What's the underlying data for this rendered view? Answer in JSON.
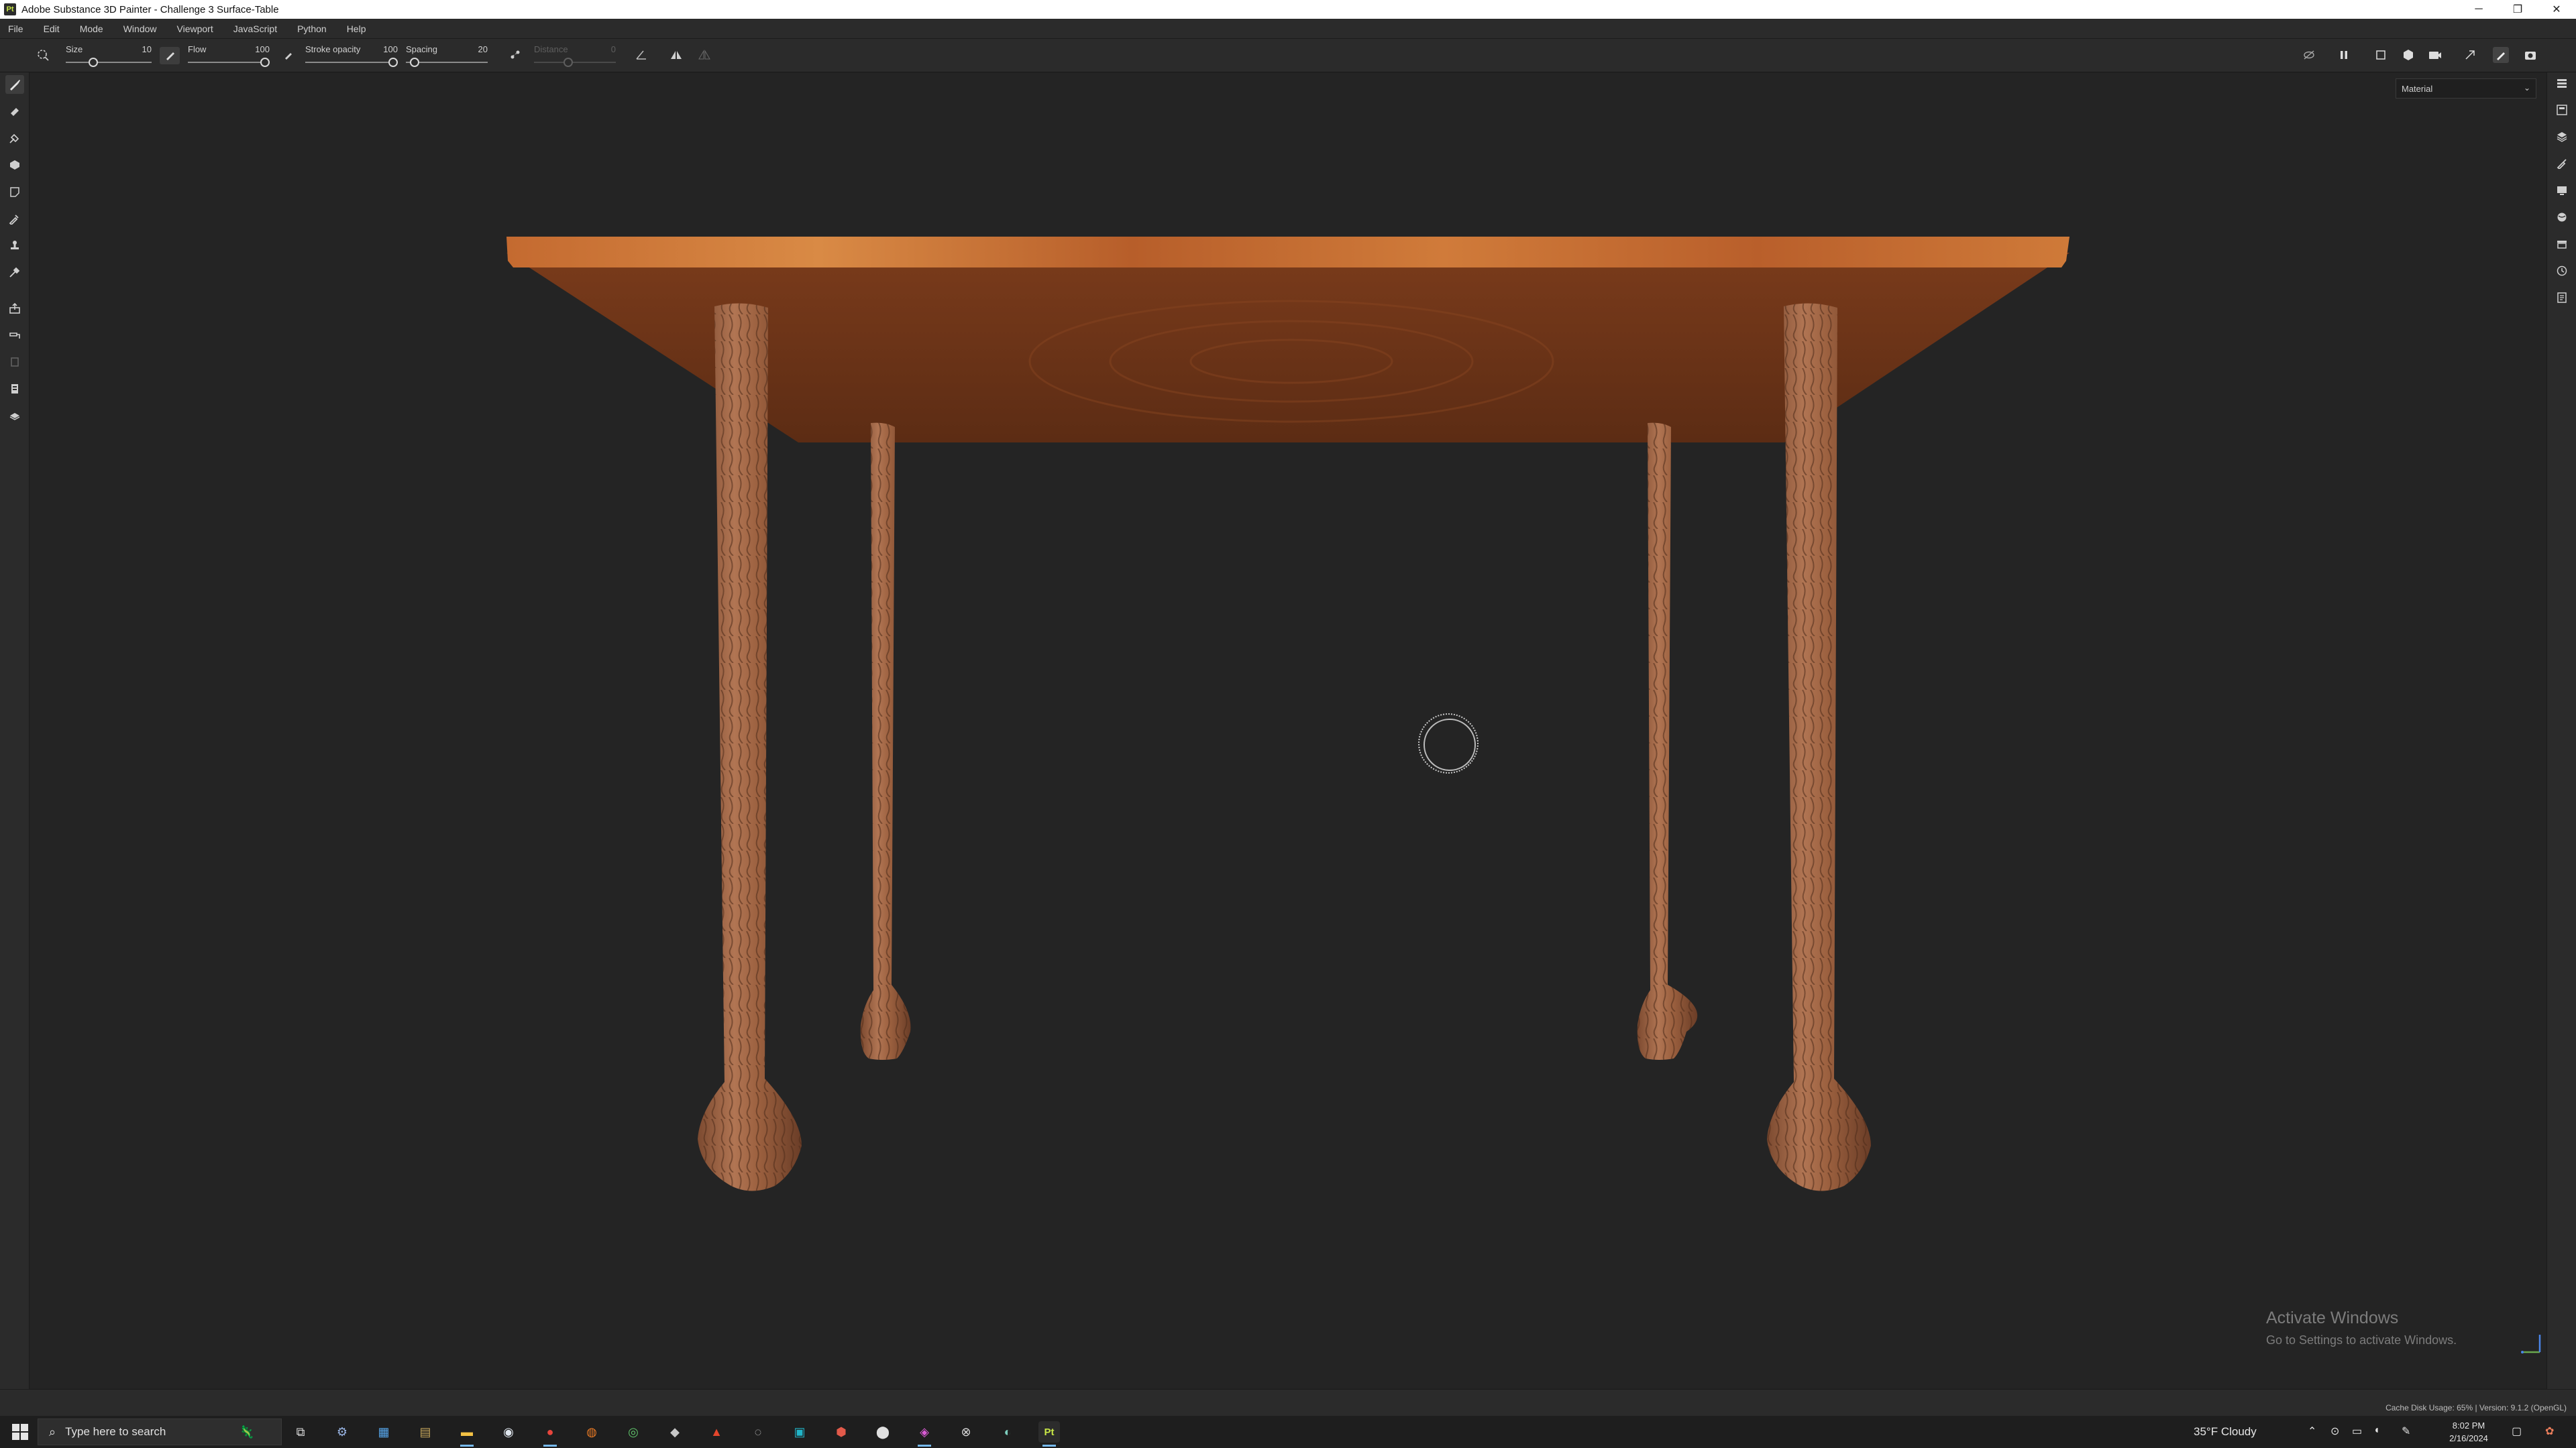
{
  "window": {
    "title": "Adobe Substance 3D Painter - Challenge 3 Surface-Table",
    "app_icon_text": "Pt",
    "minimize": "─",
    "restore": "❐",
    "close": "✕"
  },
  "menu": [
    "File",
    "Edit",
    "Mode",
    "Window",
    "Viewport",
    "JavaScript",
    "Python",
    "Help"
  ],
  "toolbar": {
    "size": {
      "label": "Size",
      "value": "10"
    },
    "flow": {
      "label": "Flow",
      "value": "100"
    },
    "stroke_opacity": {
      "label": "Stroke opacity",
      "value": "100"
    },
    "spacing": {
      "label": "Spacing",
      "value": "20"
    },
    "distance": {
      "label": "Distance",
      "value": "0"
    }
  },
  "viewport": {
    "view_mode": "Material",
    "watermark_title": "Activate Windows",
    "watermark_sub": "Go to Settings to activate Windows."
  },
  "status": {
    "text": "Cache Disk Usage:  65% | Version: 9.1.2 (OpenGL)"
  },
  "taskbar": {
    "search_placeholder": "Type here to search",
    "weather": "35°F  Cloudy",
    "time": "8:02 PM",
    "date": "2/16/2024"
  },
  "colors": {
    "accent": "#c9e846",
    "wood_top": "#c7692d",
    "wood_under": "#6b3418",
    "leg": "#9a5f3e"
  }
}
